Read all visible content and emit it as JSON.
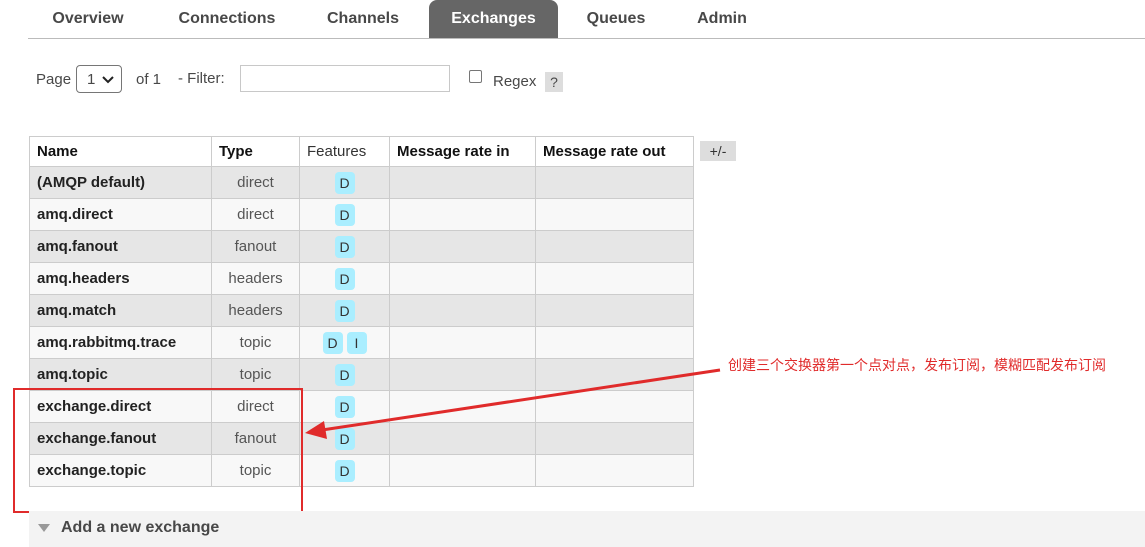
{
  "tabs": [
    {
      "label": "Overview",
      "active": false
    },
    {
      "label": "Connections",
      "active": false
    },
    {
      "label": "Channels",
      "active": false
    },
    {
      "label": "Exchanges",
      "active": true
    },
    {
      "label": "Queues",
      "active": false
    },
    {
      "label": "Admin",
      "active": false
    }
  ],
  "paging": {
    "page_label": "Page",
    "page_value": "1",
    "of_label": "of 1",
    "filter_label": "- Filter:",
    "filter_value": "",
    "regex_label": "Regex",
    "regex_checked": false,
    "help_label": "?"
  },
  "table": {
    "columns": [
      "Name",
      "Type",
      "Features",
      "Message rate in",
      "Message rate out"
    ],
    "toggle_label": "+/-",
    "rows": [
      {
        "name": "(AMQP default)",
        "type": "direct",
        "features": [
          "D"
        ],
        "rate_in": "",
        "rate_out": ""
      },
      {
        "name": "amq.direct",
        "type": "direct",
        "features": [
          "D"
        ],
        "rate_in": "",
        "rate_out": ""
      },
      {
        "name": "amq.fanout",
        "type": "fanout",
        "features": [
          "D"
        ],
        "rate_in": "",
        "rate_out": ""
      },
      {
        "name": "amq.headers",
        "type": "headers",
        "features": [
          "D"
        ],
        "rate_in": "",
        "rate_out": ""
      },
      {
        "name": "amq.match",
        "type": "headers",
        "features": [
          "D"
        ],
        "rate_in": "",
        "rate_out": ""
      },
      {
        "name": "amq.rabbitmq.trace",
        "type": "topic",
        "features": [
          "D",
          "I"
        ],
        "rate_in": "",
        "rate_out": ""
      },
      {
        "name": "amq.topic",
        "type": "topic",
        "features": [
          "D"
        ],
        "rate_in": "",
        "rate_out": ""
      },
      {
        "name": "exchange.direct",
        "type": "direct",
        "features": [
          "D"
        ],
        "rate_in": "",
        "rate_out": ""
      },
      {
        "name": "exchange.fanout",
        "type": "fanout",
        "features": [
          "D"
        ],
        "rate_in": "",
        "rate_out": ""
      },
      {
        "name": "exchange.topic",
        "type": "topic",
        "features": [
          "D"
        ],
        "rate_in": "",
        "rate_out": ""
      }
    ]
  },
  "annotation": {
    "text": "创建三个交换器第一个点对点，发布订阅，模糊匹配发布订阅",
    "color": "#e02b2b"
  },
  "add_section": {
    "label": "Add a new exchange"
  },
  "colors": {
    "active_tab": "#666666",
    "feature_badge": "#aaeeff",
    "row_alt": "#e6e6e6",
    "row_norm": "#f8f8f8"
  }
}
